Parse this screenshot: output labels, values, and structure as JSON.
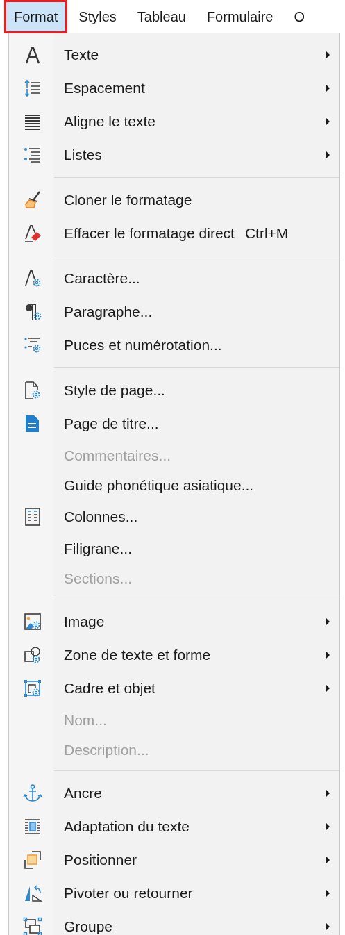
{
  "menubar": [
    {
      "label": "Format",
      "selected": true
    },
    {
      "label": "Styles",
      "selected": false
    },
    {
      "label": "Tableau",
      "selected": false
    },
    {
      "label": "Formulaire",
      "selected": false
    },
    {
      "label": "O",
      "selected": false
    }
  ],
  "menu": {
    "sections": [
      {
        "items": [
          {
            "label": "Texte",
            "submenu": true,
            "disabled": false
          },
          {
            "label": "Espacement",
            "submenu": true,
            "disabled": false
          },
          {
            "label": "Aligne le texte",
            "submenu": true,
            "disabled": false
          },
          {
            "label": "Listes",
            "submenu": true,
            "disabled": false
          }
        ]
      },
      {
        "items": [
          {
            "label": "Cloner le formatage",
            "submenu": false,
            "disabled": false
          },
          {
            "label": "Effacer le formatage direct",
            "shortcut": "Ctrl+M",
            "submenu": false,
            "disabled": false
          }
        ]
      },
      {
        "items": [
          {
            "label": "Caractère...",
            "submenu": false,
            "disabled": false
          },
          {
            "label": "Paragraphe...",
            "submenu": false,
            "disabled": false
          },
          {
            "label": "Puces et numérotation...",
            "submenu": false,
            "disabled": false
          }
        ]
      },
      {
        "items": [
          {
            "label": "Style de page...",
            "submenu": false,
            "disabled": false
          },
          {
            "label": "Page de titre...",
            "submenu": false,
            "disabled": false
          },
          {
            "label": "Commentaires...",
            "submenu": false,
            "disabled": true
          },
          {
            "label": "Guide phonétique asiatique...",
            "submenu": false,
            "disabled": false
          },
          {
            "label": "Colonnes...",
            "submenu": false,
            "disabled": false
          },
          {
            "label": "Filigrane...",
            "submenu": false,
            "disabled": false
          },
          {
            "label": "Sections...",
            "submenu": false,
            "disabled": true
          }
        ]
      },
      {
        "items": [
          {
            "label": "Image",
            "submenu": true,
            "disabled": false
          },
          {
            "label": "Zone de texte et forme",
            "submenu": true,
            "disabled": false
          },
          {
            "label": "Cadre et objet",
            "submenu": true,
            "disabled": false
          },
          {
            "label": "Nom...",
            "submenu": false,
            "disabled": true
          },
          {
            "label": "Description...",
            "submenu": false,
            "disabled": true
          }
        ]
      },
      {
        "items": [
          {
            "label": "Ancre",
            "submenu": true,
            "disabled": false
          },
          {
            "label": "Adaptation du texte",
            "submenu": true,
            "disabled": false
          },
          {
            "label": "Positionner",
            "submenu": true,
            "disabled": false
          },
          {
            "label": "Pivoter ou retourner",
            "submenu": true,
            "disabled": false
          },
          {
            "label": "Groupe",
            "submenu": true,
            "disabled": false
          }
        ]
      }
    ]
  }
}
